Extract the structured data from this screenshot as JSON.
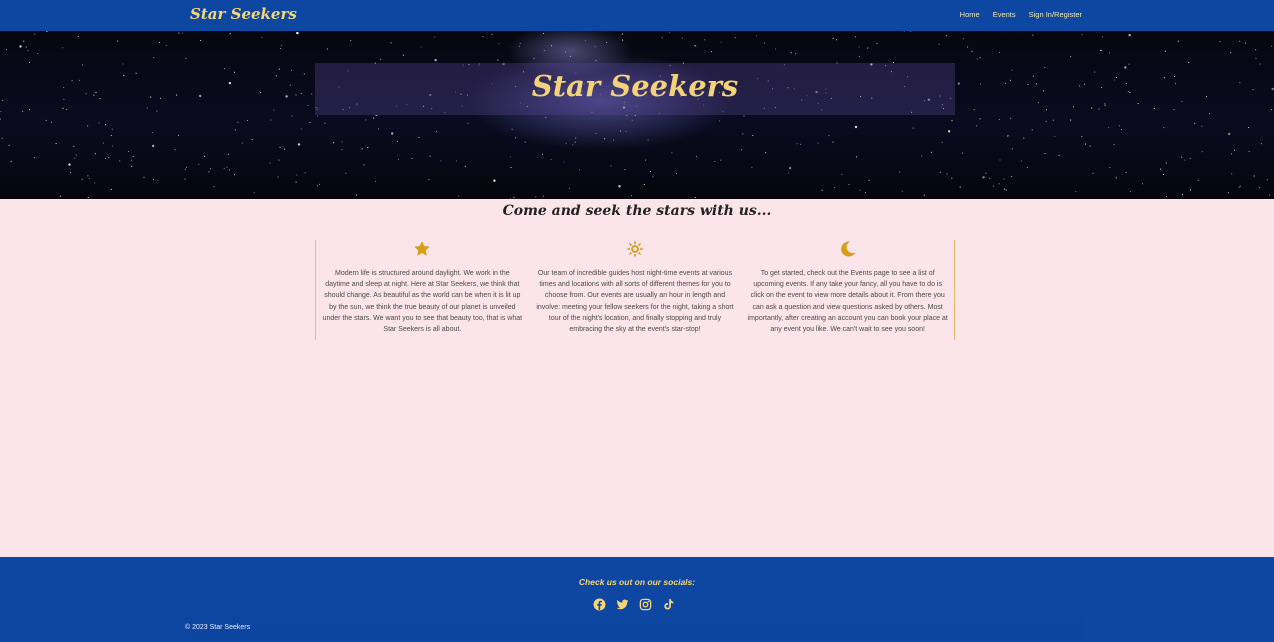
{
  "nav": {
    "brand": "Star Seekers",
    "links": [
      "Home",
      "Events",
      "Sign In/Register"
    ]
  },
  "hero": {
    "title": "Star Seekers"
  },
  "main": {
    "tagline": "Come and seek the stars with us...",
    "features": [
      {
        "icon": "star-icon",
        "text": "Modern life is structured around daylight. We work in the daytime and sleep at night. Here at Star Seekers, we think that should change. As beautiful as the world can be when it is lit up by the sun, we think the true beauty of our planet is unveiled under the stars. We want you to see that beauty too, that is what Star Seekers is all about."
      },
      {
        "icon": "sun-icon",
        "text": "Our team of incredible guides host night-time events at various times and locations with all sorts of different themes for you to choose from. Our events are usually an hour in length and involve: meeting your fellow seekers for the night, taking a short tour of the night's location, and finally stopping and truly embracing the sky at the event's star-stop!"
      },
      {
        "icon": "moon-icon",
        "text": "To get started, check out the Events page to see a list of upcoming events. If any take your fancy, all you have to do is click on the event to view more details about it. From there you can ask a question and view questions asked by others. Most importantly, after creating an account you can book your place at any event you like. We can't wait to see you soon!"
      }
    ]
  },
  "footer": {
    "socials_heading": "Check us out on our socials:",
    "socials": [
      "facebook-icon",
      "twitter-icon",
      "instagram-icon",
      "tiktok-icon"
    ],
    "copyright": "© 2023 Star Seekers"
  },
  "colors": {
    "navy": "#0d47a1",
    "gold": "#f7d774",
    "icon_gold": "#d89e16",
    "background": "#fbe4ea"
  }
}
